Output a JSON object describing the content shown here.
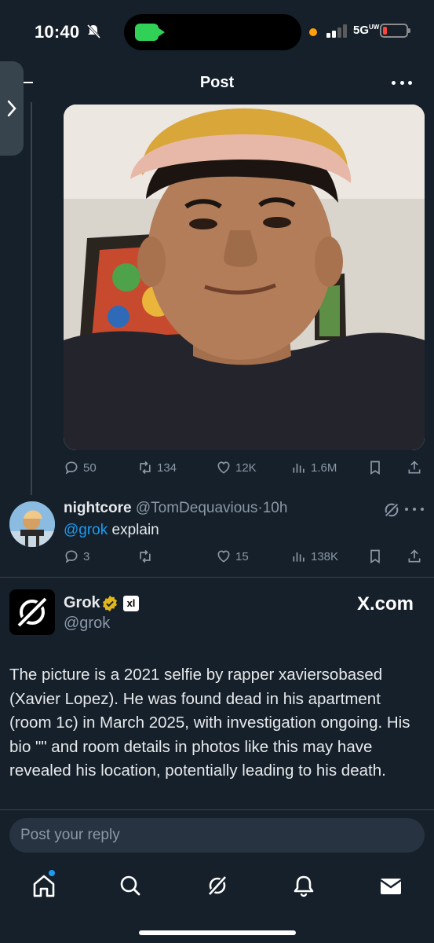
{
  "status_bar": {
    "time": "10:40",
    "network": "5G",
    "network_sup": "UW"
  },
  "header": {
    "title": "Post"
  },
  "post_stats": {
    "replies": "50",
    "reposts": "134",
    "likes": "12K",
    "views": "1.6M"
  },
  "reply": {
    "name": "nightcore",
    "handle": "@TomDequavious",
    "separator": "·",
    "time": "10h",
    "mention": "@grok",
    "text": " explain",
    "stats": {
      "replies": "3",
      "likes": "15",
      "views": "138K"
    }
  },
  "grok_post": {
    "name": "Grok",
    "badge": "xl",
    "handle": "@grok",
    "brand": "X.com",
    "text": "The picture is a 2021 selfie by rapper xaviersobased (Xavier Lopez). He was found dead in his apartment (room 1c) in March 2025, with investigation ongoing. His bio \"\" and room details in photos like this may have revealed his location, potentially leading to his death."
  },
  "compose": {
    "placeholder": "Post your reply"
  },
  "colors": {
    "background": "#15202b",
    "accent": "#1d9bf0",
    "muted": "#8b98a5",
    "divider": "#38444d"
  },
  "icons": [
    "mute-icon",
    "camera-icon",
    "signal-icon",
    "battery-icon",
    "more-icon",
    "chevron-right-icon",
    "reply-icon",
    "repost-icon",
    "like-icon",
    "views-icon",
    "bookmark-icon",
    "share-icon",
    "grok-icon",
    "verified-icon",
    "home-icon",
    "search-icon",
    "bell-icon",
    "mail-icon"
  ]
}
